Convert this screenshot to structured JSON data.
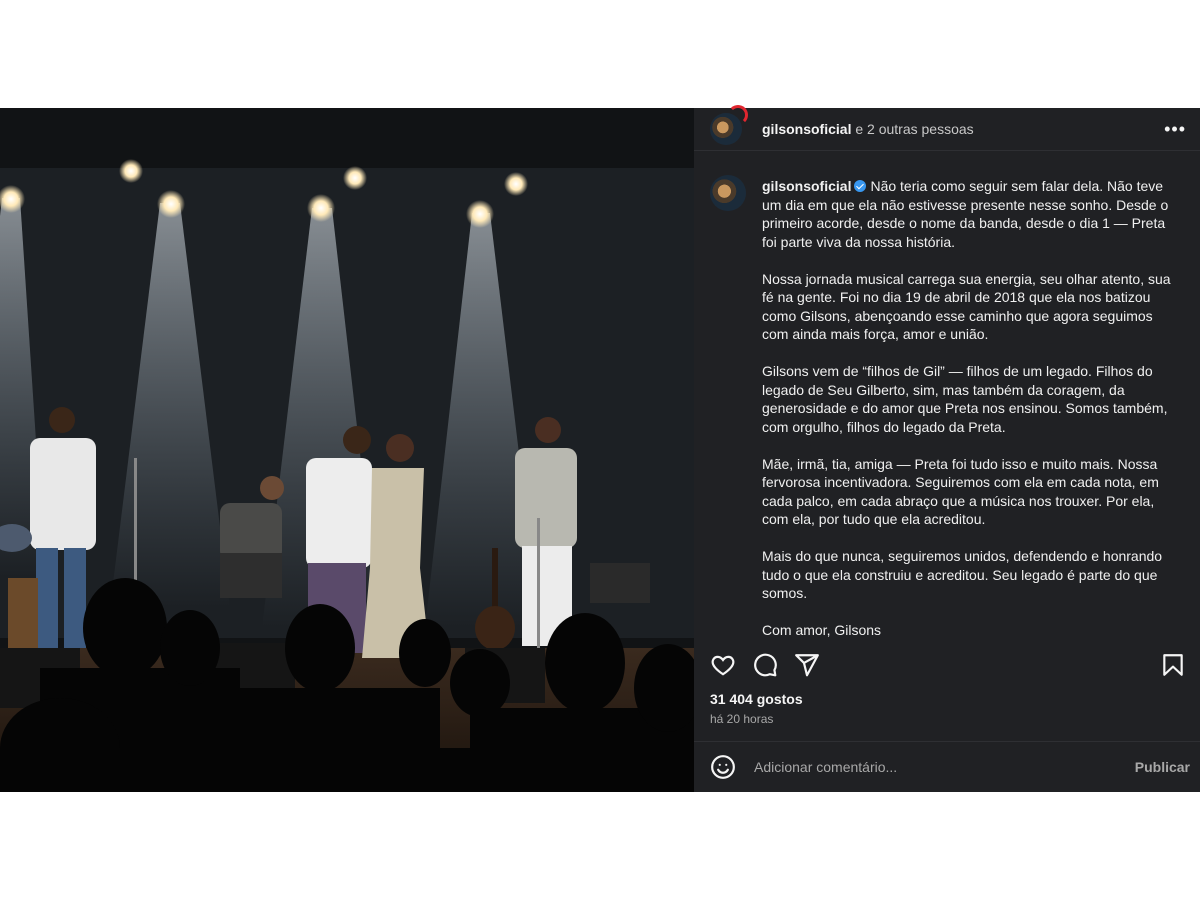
{
  "post": {
    "header": {
      "username": "gilsonsoficial",
      "others": "e 2 outras pessoas"
    },
    "caption": {
      "author": "gilsonsoficial",
      "paragraphs": [
        "Não teria como seguir sem falar dela. Não teve um dia em que ela não estivesse presente nesse sonho. Desde o primeiro acorde, desde o nome da banda, desde o dia 1 — Preta foi parte viva da nossa história.",
        "Nossa jornada musical carrega sua energia, seu olhar atento, sua fé na gente. Foi no dia 19 de abril de 2018 que ela nos batizou como Gilsons, abençoando esse caminho que agora seguimos com ainda mais força, amor e união.",
        "Gilsons vem de “filhos de Gil” — filhos de um legado. Filhos do legado de Seu Gilberto, sim, mas também da coragem, da generosidade e do amor que Preta nos ensinou. Somos também, com orgulho, filhos do legado da Preta.",
        "Mãe, irmã, tia, amiga — Preta foi tudo isso e muito mais. Nossa fervorosa incentivadora. Seguiremos com ela em cada nota, em cada palco, em cada abraço que a música nos trouxer. Por ela, com ela, por tudo que ela acreditou.",
        "Mais do que nunca, seguiremos unidos, defendendo e honrando tudo o que ela construiu e acreditou. Seu legado é parte do que somos.",
        "Com amor, Gilsons"
      ]
    },
    "likes": "31 404 gostos",
    "time": "há 20 horas",
    "comment": {
      "placeholder": "Adicionar comentário...",
      "publish": "Publicar"
    },
    "icons": {
      "like": "heart-icon",
      "comment": "comment-icon",
      "share": "send-icon",
      "save": "bookmark-icon",
      "emoji": "emoji-icon",
      "more": "more-options-icon"
    },
    "colors": {
      "panel_bg": "#202124",
      "text": "#f5f5f5",
      "muted": "#a8a8a8",
      "verified": "#3897f0",
      "story_ring": "#e0262f"
    }
  }
}
